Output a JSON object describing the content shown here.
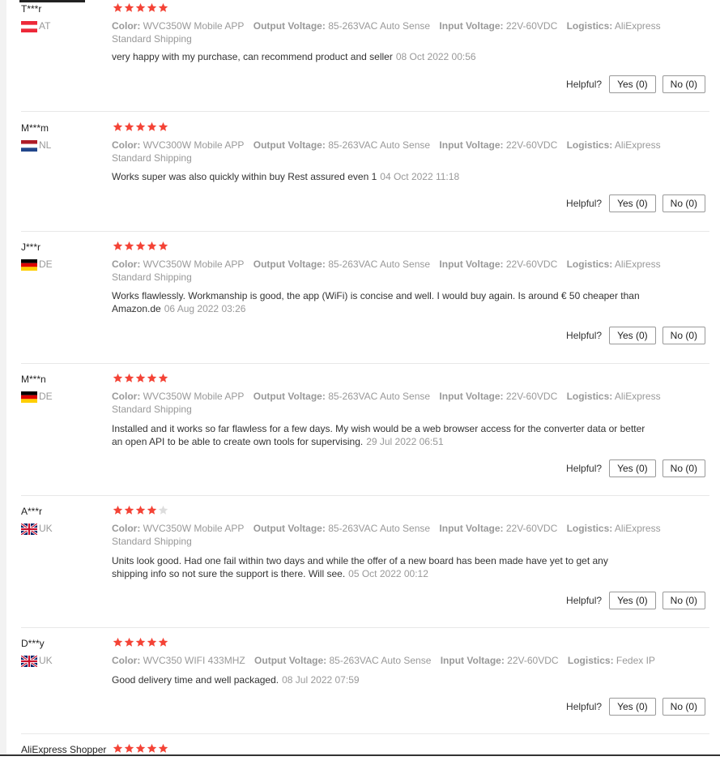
{
  "colors": {
    "star_filled": "#f44336",
    "star_empty": "#dddddd",
    "muted": "#999999"
  },
  "labels": {
    "color": "Color:",
    "output": "Output Voltage:",
    "input": "Input Voltage:",
    "logistics": "Logistics:",
    "helpful": "Helpful?"
  },
  "reviews": [
    {
      "user": "T***r",
      "country": "AT",
      "flag_icon": "austria-flag-icon",
      "rating": 5,
      "attrs": {
        "color": "WVC350W Mobile APP",
        "output": "85-263VAC Auto Sense",
        "input": "22V-60VDC",
        "logistics": "AliExpress Standard Shipping"
      },
      "text": "very happy with my purchase, can recommend product and seller",
      "date": "08 Oct 2022 00:56",
      "yes": "Yes (0)",
      "no": "No (0)"
    },
    {
      "user": "M***m",
      "country": "NL",
      "flag_icon": "netherlands-flag-icon",
      "rating": 5,
      "attrs": {
        "color": "WVC300W Mobile APP",
        "output": "85-263VAC Auto Sense",
        "input": "22V-60VDC",
        "logistics": "AliExpress Standard Shipping"
      },
      "text": "Works super was also quickly within buy Rest assured even 1",
      "date": "04 Oct 2022 11:18",
      "yes": "Yes (0)",
      "no": "No (0)"
    },
    {
      "user": "J***r",
      "country": "DE",
      "flag_icon": "germany-flag-icon",
      "rating": 5,
      "attrs": {
        "color": "WVC350W Mobile APP",
        "output": "85-263VAC Auto Sense",
        "input": "22V-60VDC",
        "logistics": "AliExpress Standard Shipping"
      },
      "text": "Works flawlessly. Workmanship is good, the app (WiFi) is concise and well. I would buy again. Is around € 50 cheaper than Amazon.de",
      "date": "06 Aug 2022 03:26",
      "yes": "Yes (0)",
      "no": "No (0)"
    },
    {
      "user": "M***n",
      "country": "DE",
      "flag_icon": "germany-flag-icon",
      "rating": 5,
      "attrs": {
        "color": "WVC350W Mobile APP",
        "output": "85-263VAC Auto Sense",
        "input": "22V-60VDC",
        "logistics": "AliExpress Standard Shipping"
      },
      "text": "Installed and it works so far flawless for a few days. My wish would be a web browser access for the converter data or better an open API to be able to create own tools for supervising.",
      "date": "29 Jul 2022 06:51",
      "yes": "Yes (0)",
      "no": "No (0)"
    },
    {
      "user": "A***r",
      "country": "UK",
      "flag_icon": "uk-flag-icon",
      "rating": 4,
      "attrs": {
        "color": "WVC350W Mobile APP",
        "output": "85-263VAC Auto Sense",
        "input": "22V-60VDC",
        "logistics": "AliExpress Standard Shipping"
      },
      "text": "Units look good. Had one fail within two days and while the offer of a new board has been made have yet to get any shipping info so not sure the support is there. Will see.",
      "date": "05 Oct 2022 00:12",
      "yes": "Yes (0)",
      "no": "No (0)"
    },
    {
      "user": "D***y",
      "country": "UK",
      "flag_icon": "uk-flag-icon",
      "rating": 5,
      "attrs": {
        "color": "WVC350 WIFI 433MHZ",
        "output": "85-263VAC Auto Sense",
        "input": "22V-60VDC",
        "logistics": "Fedex IP"
      },
      "text": "Good delivery time and well packaged.",
      "date": "08 Jul 2022 07:59",
      "yes": "Yes (0)",
      "no": "No (0)"
    },
    {
      "user": "AliExpress Shopper",
      "country": "",
      "flag_icon": "",
      "rating": 5,
      "attrs": null,
      "text": "",
      "date": "",
      "yes": "",
      "no": ""
    }
  ]
}
